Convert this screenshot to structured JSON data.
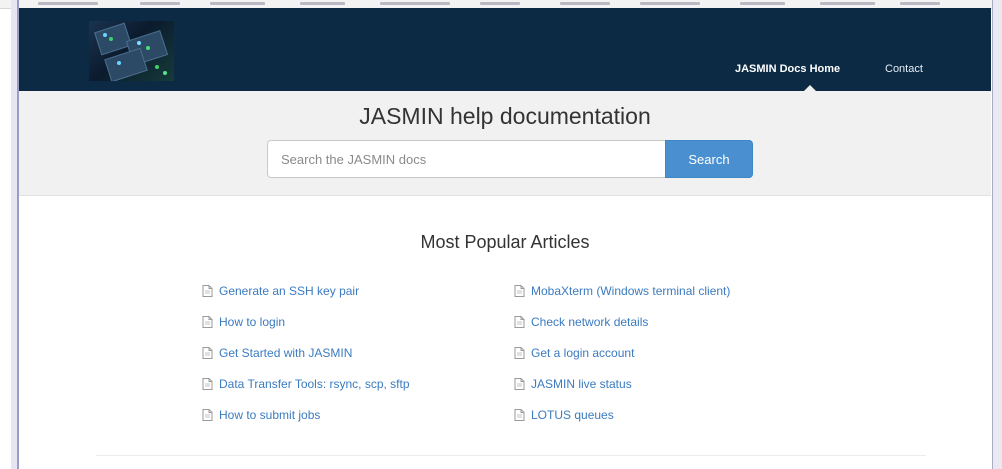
{
  "navbar": {
    "home_label": "JASMIN Docs Home",
    "contact_label": "Contact",
    "logo_icon": "server-rack-logo-icon",
    "background": "#0c2a44"
  },
  "hero": {
    "title": "JASMIN help documentation",
    "search": {
      "placeholder": "Search the JASMIN docs",
      "value": "",
      "button_label": "Search"
    },
    "accent_color": "#4a90d0"
  },
  "popular": {
    "title": "Most Popular Articles",
    "icon": "document-icon",
    "left": [
      {
        "label": "Generate an SSH key pair"
      },
      {
        "label": "How to login"
      },
      {
        "label": "Get Started with JASMIN"
      },
      {
        "label": "Data Transfer Tools: rsync, scp, sftp"
      },
      {
        "label": "How to submit jobs"
      }
    ],
    "right": [
      {
        "label": "MobaXterm (Windows terminal client)"
      },
      {
        "label": "Check network details"
      },
      {
        "label": "Get a login account"
      },
      {
        "label": "JASMIN live status"
      },
      {
        "label": "LOTUS queues"
      }
    ],
    "link_color": "#3b7bbf"
  }
}
